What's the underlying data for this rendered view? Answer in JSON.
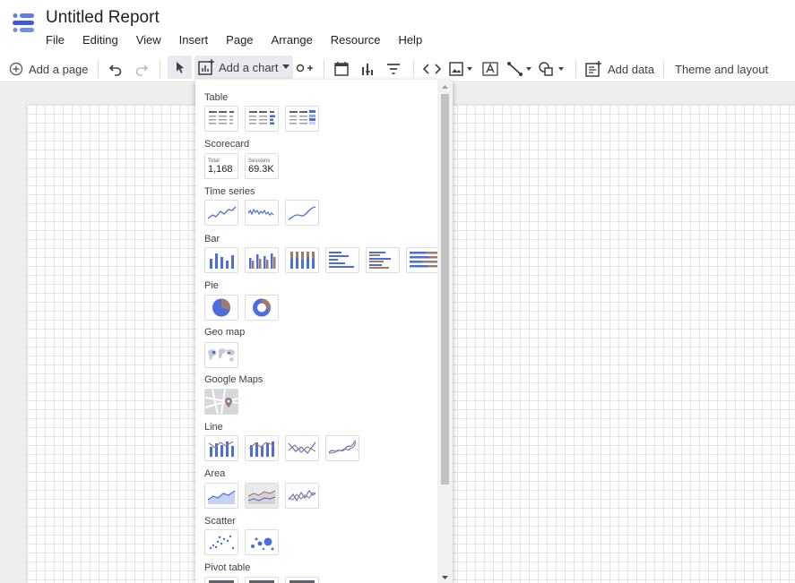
{
  "app": {
    "title": "Untitled Report"
  },
  "menubar": [
    "File",
    "Editing",
    "View",
    "Insert",
    "Page",
    "Arrange",
    "Resource",
    "Help"
  ],
  "toolbar": {
    "add_page": "Add a page",
    "add_chart": "Add a chart",
    "add_data": "Add data",
    "theme_layout": "Theme and layout"
  },
  "chart_menu": {
    "sections": {
      "table": "Table",
      "scorecard": "Scorecard",
      "time_series": "Time series",
      "bar": "Bar",
      "pie": "Pie",
      "geo_map": "Geo map",
      "google_maps": "Google Maps",
      "line": "Line",
      "area": "Area",
      "scatter": "Scatter",
      "pivot_table": "Pivot table"
    },
    "scorecards": [
      {
        "label": "Total",
        "value": "1,168"
      },
      {
        "label": "Sessions",
        "value": "69.3K"
      }
    ]
  },
  "colors": {
    "accent_blue": "#4a6ee0",
    "accent_brown": "#a17a6e",
    "selected_bg": "#e8eaed"
  }
}
